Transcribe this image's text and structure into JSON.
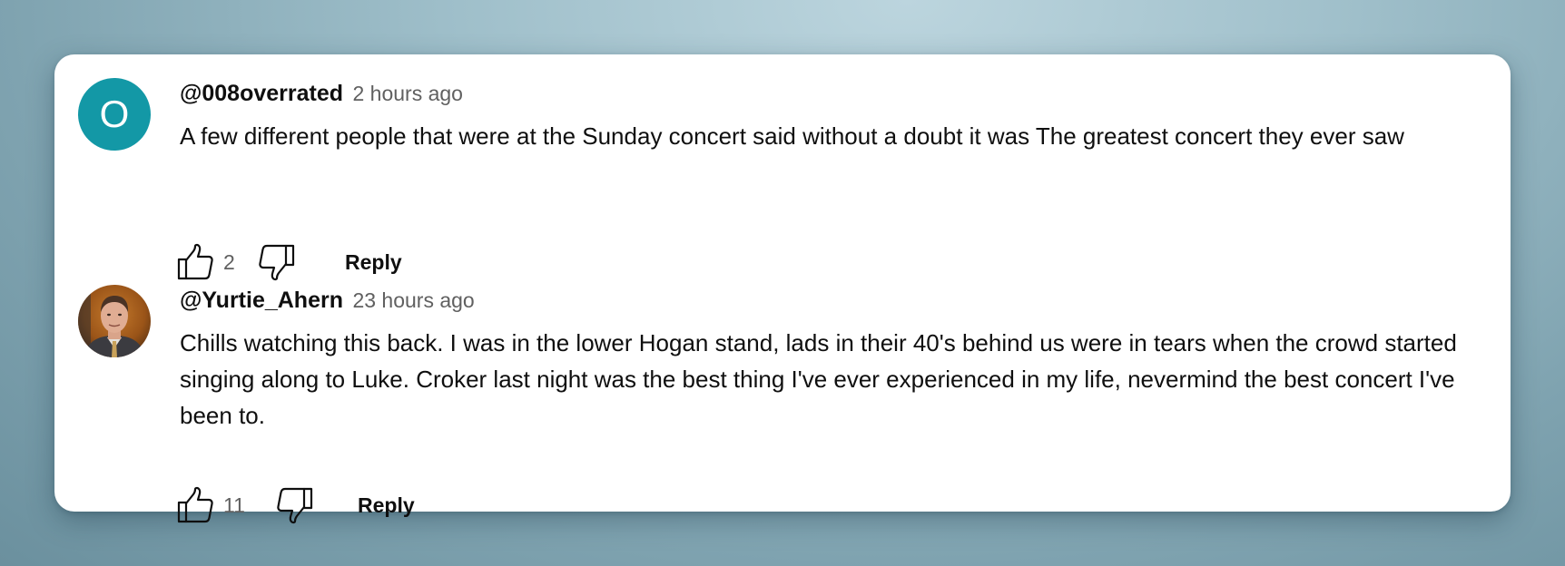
{
  "comments": [
    {
      "avatar": {
        "type": "letter",
        "letter": "O",
        "color": "#1398a6"
      },
      "author": "@008overrated",
      "timestamp": "2 hours ago",
      "text": "A few different people that were at the Sunday concert said without a doubt it was The greatest concert they ever saw",
      "like_count": "2",
      "reply_label": "Reply",
      "icons": {
        "like": "thumbs-up-icon",
        "dislike": "thumbs-down-icon"
      }
    },
    {
      "avatar": {
        "type": "photo",
        "description_icon": "profile-photo"
      },
      "author": "@Yurtie_Ahern",
      "timestamp": "23 hours ago",
      "text": "Chills watching this back. I was in the lower Hogan stand, lads in their 40's behind us were in tears when the crowd started singing along to Luke. Croker last night was the best thing I've ever experienced in my life, nevermind the best concert I've been to.",
      "like_count": "11",
      "reply_label": "Reply",
      "icons": {
        "like": "thumbs-up-icon",
        "dislike": "thumbs-down-icon"
      }
    }
  ]
}
